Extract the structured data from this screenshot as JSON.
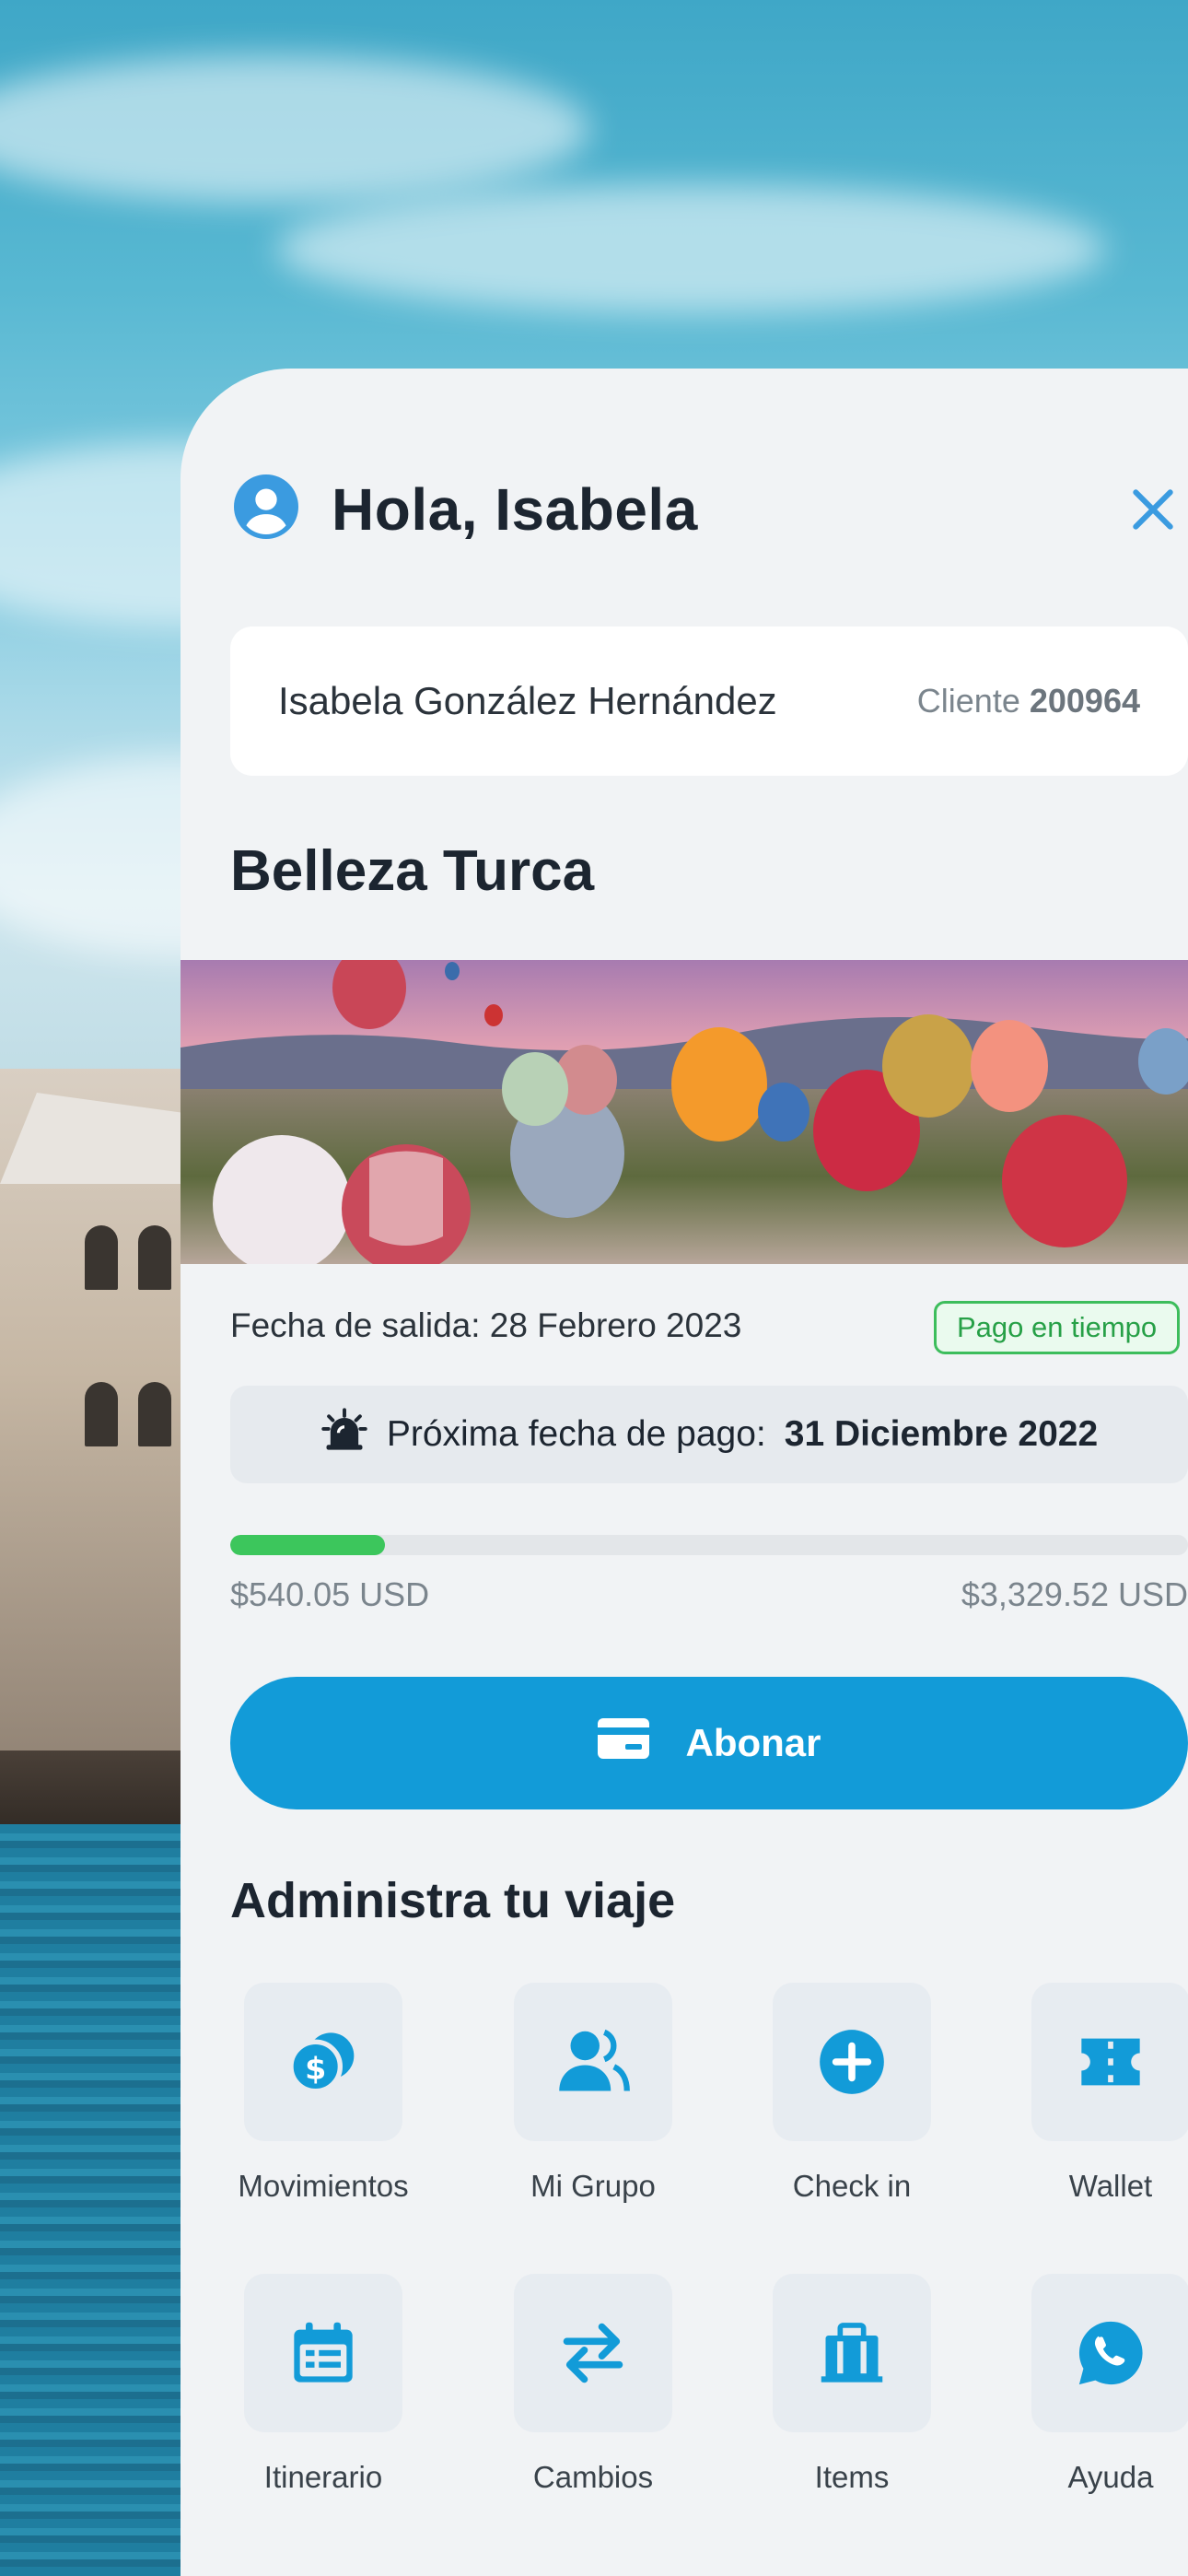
{
  "greeting": "Hola, Isabela",
  "client": {
    "name": "Isabela González Hernández",
    "label": "Cliente",
    "number": "200964"
  },
  "trip": {
    "title": "Belleza Turca",
    "departure": "Fecha de salida: 28 Febrero 2023",
    "status_badge": "Pago en tiempo",
    "next_payment_label": "Próxima fecha de pago:",
    "next_payment_date": "31 Diciembre 2022",
    "paid_amount": "$540.05 USD",
    "total_amount": "$3,329.52 USD",
    "paid_fraction": 0.162
  },
  "pay_button": "Abonar",
  "manage": {
    "title": "Administra tu viaje",
    "items": [
      {
        "label": "Movimientos",
        "icon": "coins-icon"
      },
      {
        "label": "Mi Grupo",
        "icon": "group-icon"
      },
      {
        "label": "Check in",
        "icon": "plus-circle-icon"
      },
      {
        "label": "Wallet",
        "icon": "ticket-icon"
      },
      {
        "label": "Itinerario",
        "icon": "calendar-icon"
      },
      {
        "label": "Cambios",
        "icon": "swap-arrows-icon"
      },
      {
        "label": "Items",
        "icon": "luggage-icon"
      },
      {
        "label": "Ayuda",
        "icon": "whatsapp-icon"
      }
    ]
  },
  "colors": {
    "accent": "#129bd8",
    "success": "#3cc65c",
    "text": "#1c2530"
  }
}
